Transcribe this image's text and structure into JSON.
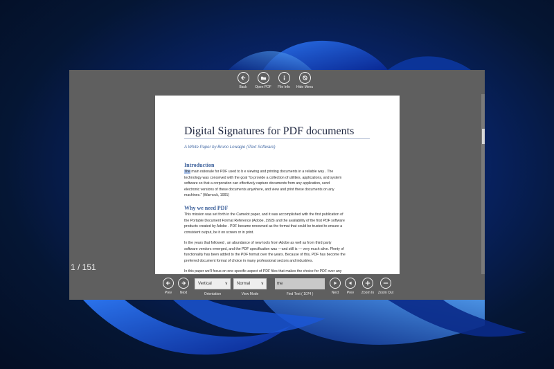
{
  "top_toolbar": {
    "buttons": [
      {
        "label": "Back",
        "icon": "back-arrow-icon"
      },
      {
        "label": "Open PDF",
        "icon": "open-folder-icon"
      },
      {
        "label": "File Info",
        "icon": "info-icon"
      },
      {
        "label": "Hide Menu",
        "icon": "hide-menu-icon"
      }
    ]
  },
  "page_counter": "1 / 151",
  "document": {
    "title": "Digital Signatures for PDF documents",
    "subtitle": "A White Paper    by Bruno Lowagie (iText Software)",
    "sections": [
      {
        "heading": "Introduction",
        "highlight": "The",
        "first_line_rest": " main rationale for PDF used to b    e viewing and  printing  documents  in a reliable way   . The",
        "lines": [
          "technology was conceived with the goal  \"to provide a collection of  utilities, applications, and system",
          "software so that a corporation can effectively capture documents  from any application, send",
          "electronic versions of these documents anywhere, and view and print these documents on any",
          "machines.\" (Warnock, 1991)"
        ]
      },
      {
        "heading": "Why we need PDF",
        "lines": [
          "This mission was set forth in the Camelot  paper, and it was accomplished with the first publication of",
          "the Portable Document Format Reference (Adobe, 1993) and the availability of the first PDF software",
          "products created by Adobe . PDF became renowned as the format that could be trusted to ensure a",
          "consistent output, be it on screen or in print."
        ]
      }
    ],
    "para3": [
      "In the years that followed    , an abundance   of new   tools from Adobe as well as from third party",
      "software vendors emerged, and the PDF specification   was  —and still is — very much alive.  Plenty of",
      "functionality has been added to the PDF format over the years. Because of this,  PDF has become the",
      "preferred document format of choice in many professional sectors and industries."
    ],
    "para4": [
      "In this paper  we'll focus on one specific aspect of PDF files that makes the choice for PDF over any"
    ]
  },
  "bottom_toolbar": {
    "prev_label": "Prev",
    "next_label": "Next",
    "orientation": {
      "value": "Vertical",
      "label": "Orientation"
    },
    "view_mode": {
      "value": "Normal",
      "label": "View Mode"
    },
    "find": {
      "value": "the",
      "label": "Find Text ( 1074 )"
    },
    "find_next_label": "Next",
    "find_prev_label": "Prev",
    "zoom_in_label": "Zoom In",
    "zoom_out_label": "Zoom Out"
  },
  "colors": {
    "wallpaper": "#0a2f8a",
    "window": "#5f5f5f",
    "heading": "#3b5f9a",
    "highlight": "#a9c2ea"
  }
}
